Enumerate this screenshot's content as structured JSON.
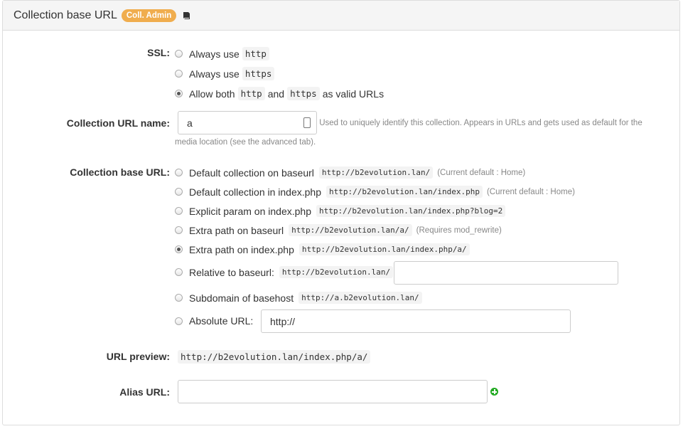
{
  "header": {
    "title": "Collection base URL",
    "badge": "Coll. Admin",
    "icon": "book-icon"
  },
  "ssl": {
    "label": "SSL:",
    "options": [
      {
        "prefix": "Always use",
        "code": "http",
        "checked": false
      },
      {
        "prefix": "Always use",
        "code": "https",
        "checked": false
      },
      {
        "prefix": "Allow both",
        "code1": "http",
        "middle": "and",
        "code2": "https",
        "suffix": "as valid URLs",
        "checked": true
      }
    ]
  },
  "url_name": {
    "label": "Collection URL name:",
    "value": "a",
    "help": "Used to uniquely identify this collection. Appears in URLs and gets used as default for the media location (see the advanced tab)."
  },
  "base_url": {
    "label": "Collection base URL:",
    "options": [
      {
        "label": "Default collection on baseurl",
        "code": "http://b2evolution.lan/",
        "note": "(Current default : Home)",
        "checked": false
      },
      {
        "label": "Default collection in index.php",
        "code": "http://b2evolution.lan/index.php",
        "note": "(Current default : Home)",
        "checked": false
      },
      {
        "label": "Explicit param on index.php",
        "code": "http://b2evolution.lan/index.php?blog=2",
        "note": "",
        "checked": false
      },
      {
        "label": "Extra path on baseurl",
        "code": "http://b2evolution.lan/a/",
        "note": "(Requires mod_rewrite)",
        "checked": false
      },
      {
        "label": "Extra path on index.php",
        "code": "http://b2evolution.lan/index.php/a/",
        "note": "",
        "checked": true
      },
      {
        "label": "Relative to baseurl:",
        "code": "http://b2evolution.lan/",
        "note": "",
        "checked": false,
        "input_value": ""
      },
      {
        "label": "Subdomain of basehost",
        "code": "http://a.b2evolution.lan/",
        "note": "",
        "checked": false
      },
      {
        "label": "Absolute URL:",
        "code": "",
        "note": "",
        "checked": false,
        "input_value": "http://"
      }
    ]
  },
  "preview": {
    "label": "URL preview:",
    "value": "http://b2evolution.lan/index.php/a/"
  },
  "alias": {
    "label": "Alias URL:",
    "value": "",
    "add_icon": "plus-circle-icon"
  }
}
